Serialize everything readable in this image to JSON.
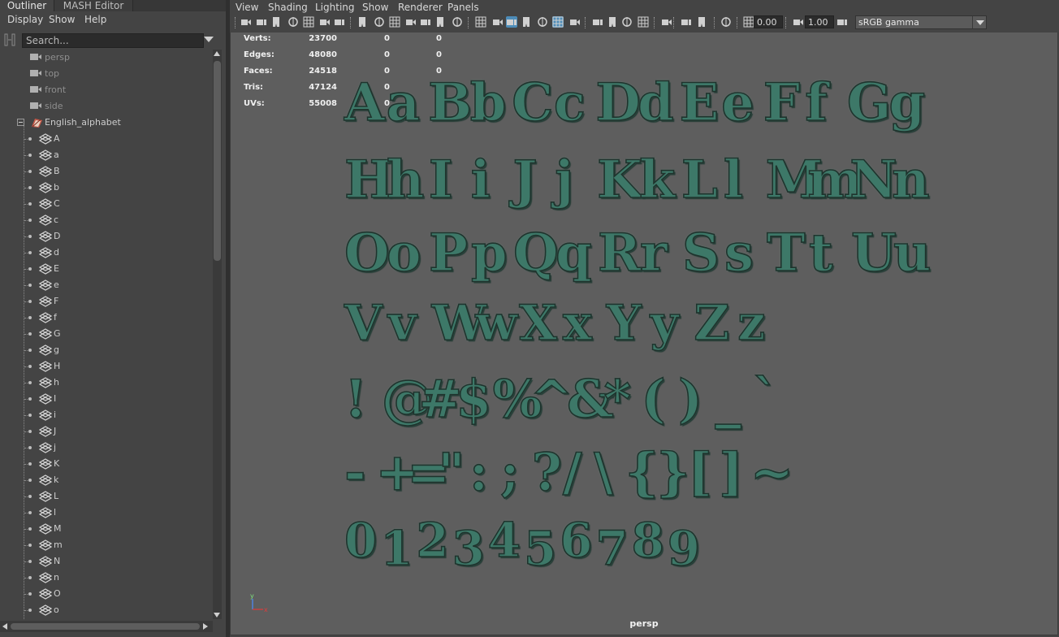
{
  "outliner": {
    "tabs": [
      "Outliner",
      "MASH Editor"
    ],
    "menu": [
      "Display",
      "Show",
      "Help"
    ],
    "search_placeholder": "Search...",
    "cameras": [
      "persp",
      "top",
      "front",
      "side"
    ],
    "group_name": "English_alphabet",
    "children": [
      "A",
      "a",
      "B",
      "b",
      "C",
      "c",
      "D",
      "d",
      "E",
      "e",
      "F",
      "f",
      "G",
      "g",
      "H",
      "h",
      "I",
      "i",
      "J",
      "j",
      "K",
      "k",
      "L",
      "l",
      "M",
      "m",
      "N",
      "n",
      "O",
      "o"
    ]
  },
  "viewport": {
    "menu": [
      "View",
      "Shading",
      "Lighting",
      "Show",
      "Renderer",
      "Panels"
    ],
    "toolbar": {
      "exposure_value": "0.00",
      "gamma_value": "1.00",
      "color_space": "sRGB gamma",
      "icons": [
        "select-camera-icon",
        "camera-attributes-icon",
        "bookmarks-icon",
        "image-plane-icon",
        "grid-icon",
        "film-gate-icon",
        "resolution-gate-icon",
        "gate-mask-icon",
        "field-chart-icon",
        "safe-action-icon",
        "safe-title-icon",
        "wireframe-icon",
        "smooth-shade-icon",
        "use-default-material-icon",
        "wireframe-on-shaded-icon",
        "textured-icon",
        "use-all-lights-icon",
        "shadows-icon",
        "screen-space-ao-icon",
        "motion-blur-icon",
        "multisample-aa-icon",
        "depth-of-field-icon",
        "isolate-select-icon",
        "xray-icon",
        "xray-active-components-icon",
        "xray-joints-icon",
        "backface-culling-icon",
        "exposure-icon",
        "gamma-icon",
        "color-management-icon"
      ]
    },
    "hud": {
      "rows": [
        {
          "label": "Verts:",
          "values": [
            "23700",
            "0",
            "0"
          ]
        },
        {
          "label": "Edges:",
          "values": [
            "48080",
            "0",
            "0"
          ]
        },
        {
          "label": "Faces:",
          "values": [
            "24518",
            "0",
            "0"
          ]
        },
        {
          "label": "Tris:",
          "values": [
            "47124",
            "0",
            "0"
          ]
        },
        {
          "label": "UVs:",
          "values": [
            "55008",
            "0",
            "0"
          ]
        }
      ]
    },
    "glyph_rows": [
      [
        "A",
        "a",
        "B",
        "b",
        "C",
        "c",
        "D",
        "d",
        "E",
        "e",
        "F",
        "f",
        "G",
        "g"
      ],
      [
        "H",
        "h",
        "I",
        "i",
        "J",
        "j",
        "K",
        "k",
        "L",
        "l",
        "M",
        "m",
        "N",
        "n"
      ],
      [
        "O",
        "o",
        "P",
        "p",
        "Q",
        "q",
        "R",
        "r",
        "S",
        "s",
        "T",
        "t",
        "U",
        "u"
      ],
      [
        "V",
        "v",
        "W",
        "w",
        "X",
        "x",
        "Y",
        "y",
        "Z",
        "z"
      ],
      [
        "!",
        "@",
        "#",
        "$",
        "%",
        "^",
        "&",
        "*",
        "(",
        ")",
        "_",
        "`"
      ],
      [
        "-",
        "+",
        "=",
        "\"",
        ":",
        ";",
        "?",
        "/",
        "\\",
        "{",
        "}",
        "[",
        "]",
        "~"
      ],
      [
        "0",
        "1",
        "2",
        "3",
        "4",
        "5",
        "6",
        "7",
        "8",
        "9"
      ]
    ],
    "camera_name": "persp",
    "axis_labels": [
      "y",
      "x"
    ],
    "colors": {
      "background": "#5e5e5e",
      "glyph_fill": "#3d7868",
      "active_button": "#4d8cb8"
    }
  }
}
